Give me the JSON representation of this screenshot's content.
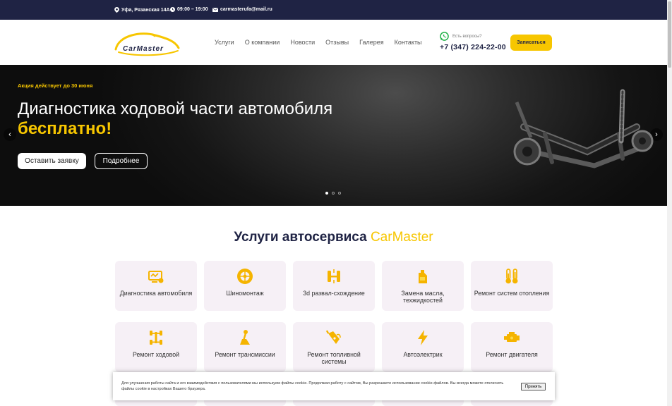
{
  "topbar": {
    "address": "Уфа, Рязанская 14А",
    "hours": "09:00 – 19:00",
    "email": "carmasterufa@mail.ru"
  },
  "header": {
    "logo_text": "CarMaster",
    "nav": [
      "Услуги",
      "О компании",
      "Новости",
      "Отзывы",
      "Галерея",
      "Контакты"
    ],
    "question": "Есть вопросы?",
    "phone": "+7 (347) 224-22-00",
    "signup_label": "Записаться"
  },
  "hero": {
    "promo": "Акция действует до 30 июня",
    "title_line1": "Диагностика ходовой части автомобиля",
    "title_line2": "бесплатно!",
    "button_request": "Оставить заявку",
    "button_more": "Подробнее",
    "prev_arrow": "‹",
    "next_arrow": "›",
    "slides_total": 3,
    "slide_active": 1
  },
  "services": {
    "title_main": "Услуги автосервиса",
    "title_brand": "CarMaster",
    "items": [
      {
        "label": "Диагностика автомобиля",
        "icon": "diagnostics-icon"
      },
      {
        "label": "Шиномонтаж",
        "icon": "tire-icon"
      },
      {
        "label": "3d развал-схождение",
        "icon": "wheel-alignment-icon"
      },
      {
        "label": "Замена масла, техжидкостей",
        "icon": "oil-can-icon"
      },
      {
        "label": "Ремонт систем отопления",
        "icon": "thermometer-icon"
      },
      {
        "label": "Ремонт ходовой",
        "icon": "chassis-icon"
      },
      {
        "label": "Ремонт трансмиссии",
        "icon": "gear-shift-icon"
      },
      {
        "label": "Ремонт топливной системы",
        "icon": "fuel-nozzle-icon"
      },
      {
        "label": "Автоэлектрик",
        "icon": "lightning-icon"
      },
      {
        "label": "Ремонт двигателя",
        "icon": "engine-icon"
      }
    ]
  },
  "cookie": {
    "text": "Для улучшения работы сайта и его взаимодействия с пользователями мы используем файлы cookie. Продолжая работу с сайтом, Вы разрешаете использование cookie-файлов. Вы всегда можете отключить файлы cookie в настройках Вашего браузера.",
    "accept_label": "Принять"
  },
  "colors": {
    "navy": "#1f2344",
    "accent": "#f7c600",
    "card_bg": "#f6f0f6"
  }
}
